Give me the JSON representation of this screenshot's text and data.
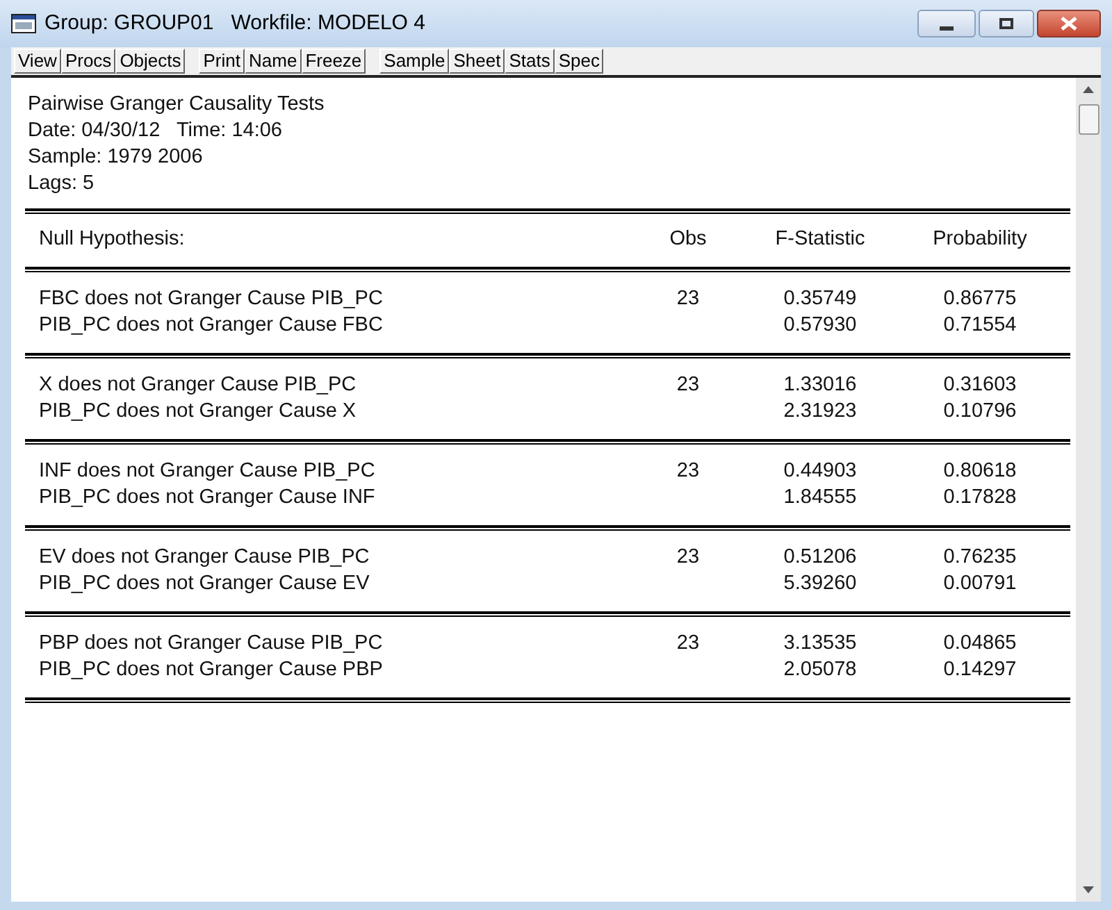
{
  "window": {
    "title": "Group: GROUP01   Workfile: MODELO 4"
  },
  "toolbar": [
    [
      "View",
      "Procs",
      "Objects"
    ],
    [
      "Print",
      "Name",
      "Freeze"
    ],
    [
      "Sample",
      "Sheet",
      "Stats",
      "Spec"
    ]
  ],
  "header": [
    "Pairwise Granger Causality Tests",
    "Date: 04/30/12   Time: 14:06",
    "Sample: 1979 2006",
    "Lags: 5"
  ],
  "table": {
    "columns": [
      "Null Hypothesis:",
      "Obs",
      "F-Statistic",
      "Probability"
    ],
    "groups": [
      {
        "rows": [
          [
            "FBC does not Granger Cause PIB_PC",
            "23",
            "0.35749",
            "0.86775"
          ],
          [
            "PIB_PC does not Granger Cause FBC",
            "",
            "0.57930",
            "0.71554"
          ]
        ]
      },
      {
        "rows": [
          [
            "X does not Granger Cause PIB_PC",
            "23",
            "1.33016",
            "0.31603"
          ],
          [
            "PIB_PC does not Granger Cause X",
            "",
            "2.31923",
            "0.10796"
          ]
        ]
      },
      {
        "rows": [
          [
            "INF does not Granger Cause PIB_PC",
            "23",
            "0.44903",
            "0.80618"
          ],
          [
            "PIB_PC does not Granger Cause INF",
            "",
            "1.84555",
            "0.17828"
          ]
        ]
      },
      {
        "rows": [
          [
            "EV does not Granger Cause PIB_PC",
            "23",
            "0.51206",
            "0.76235"
          ],
          [
            "PIB_PC does not Granger Cause EV",
            "",
            "5.39260",
            "0.00791"
          ]
        ]
      },
      {
        "rows": [
          [
            "PBP does not Granger Cause PIB_PC",
            "23",
            "3.13535",
            "0.04865"
          ],
          [
            "PIB_PC does not Granger Cause PBP",
            "",
            "2.05078",
            "0.14297"
          ]
        ]
      }
    ]
  }
}
